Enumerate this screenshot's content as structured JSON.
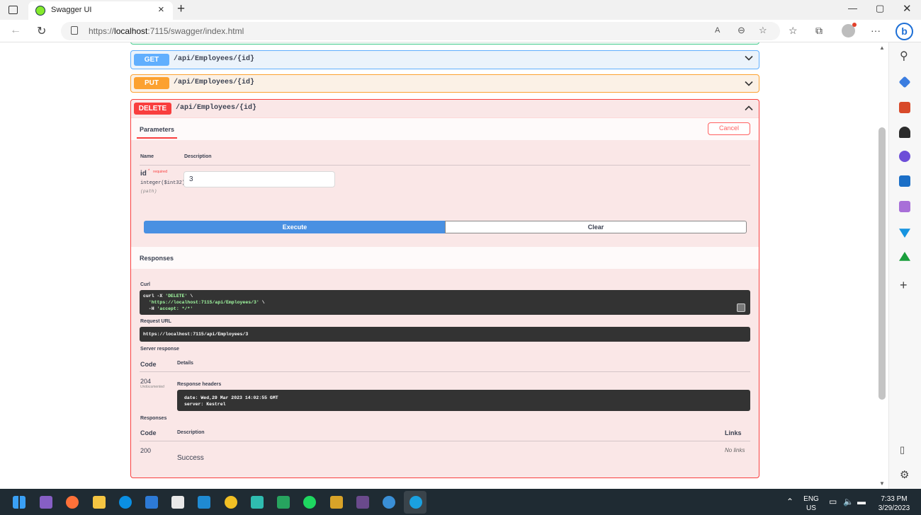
{
  "browser": {
    "tab_title": "Swagger UI",
    "url_prefix": "https://",
    "url_host": "localhost",
    "url_rest": ":7115/swagger/index.html",
    "read_aloud": "A",
    "restore_icon": "▢"
  },
  "ops": [
    {
      "method": "GET",
      "path": "/api/Employees/{id}",
      "color": "#61affe"
    },
    {
      "method": "PUT",
      "path": "/api/Employees/{id}",
      "color": "#fca130"
    },
    {
      "method": "DELETE",
      "path": "/api/Employees/{id}",
      "color": "#f93e3e"
    }
  ],
  "delete_op": {
    "parameters_tab": "Parameters",
    "cancel_label": "Cancel",
    "col_name": "Name",
    "col_description": "Description",
    "param_name": "id",
    "param_required_mark": "*",
    "param_required": "required",
    "param_type": "integer($int32)",
    "param_in": "(path)",
    "param_value": "3",
    "execute_label": "Execute",
    "clear_label": "Clear",
    "responses_heading": "Responses",
    "curl_label": "Curl",
    "curl_line1_a": "curl -X ",
    "curl_line1_b": "'DELETE'",
    "curl_line1_c": " \\",
    "curl_line2_a": "  ",
    "curl_line2_b": "'https://localhost:7115/api/Employees/3'",
    "curl_line2_c": " \\",
    "curl_line3_a": "  -H ",
    "curl_line3_b": "'accept: */*'",
    "request_url_label": "Request URL",
    "request_url": "https://localhost:7115/api/Employees/3",
    "server_response_label": "Server response",
    "code_col": "Code",
    "details_col": "Details",
    "response_code": "204",
    "response_undocumented": "Undocumented",
    "response_headers_label": "Response headers",
    "header_line1": "date: Wed,29 Mar 2023 14:02:55 GMT",
    "header_line2": "server: Kestrel",
    "responses_label": "Responses",
    "resp_code_col": "Code",
    "resp_desc_col": "Description",
    "resp_links_col": "Links",
    "resp_200_code": "200",
    "resp_200_links": "No links",
    "resp_200_desc": "Success"
  },
  "tray": {
    "lang_line1": "ENG",
    "lang_line2": "US",
    "time": "7:33 PM",
    "date": "3/29/2023"
  }
}
